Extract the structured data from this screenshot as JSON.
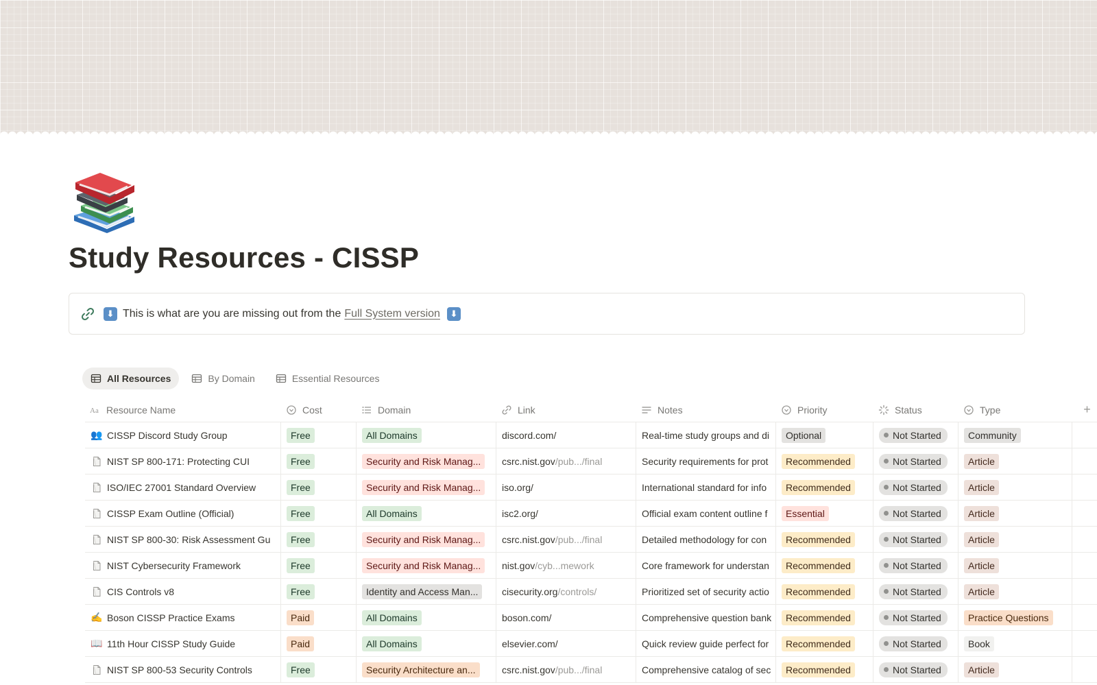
{
  "page": {
    "title": "Study Resources - CISSP",
    "icon": "books-icon"
  },
  "callout": {
    "icon": "link-icon",
    "text": "This is what are you are missing out from the",
    "link_text": "Full System version",
    "arrow_icon": "down-arrow-icon"
  },
  "views": [
    {
      "label": "All Resources",
      "active": true,
      "icon": "table-icon"
    },
    {
      "label": "By Domain",
      "active": false,
      "icon": "table-icon"
    },
    {
      "label": "Essential Resources",
      "active": false,
      "icon": "table-icon"
    }
  ],
  "columns": {
    "name": "Resource Name",
    "cost": "Cost",
    "domain": "Domain",
    "link": "Link",
    "notes": "Notes",
    "priority": "Priority",
    "status": "Status",
    "type": "Type",
    "add": "+"
  },
  "rows": [
    {
      "icon": "people-icon",
      "glyph": "👥",
      "name": "CISSP Discord Study Group",
      "cost": "Free",
      "domain": "All Domains",
      "link_main": "discord.com/",
      "link_dim": "",
      "notes": "Real-time study groups and di",
      "priority": "Optional",
      "status": "Not Started",
      "type": "Community"
    },
    {
      "icon": "document-icon",
      "glyph": "",
      "name": "NIST SP 800-171: Protecting CUI",
      "cost": "Free",
      "domain": "Security and Risk Manag...",
      "link_main": "csrc.nist.gov",
      "link_dim": "/pub.../final",
      "notes": "Security requirements for prot",
      "priority": "Recommended",
      "status": "Not Started",
      "type": "Article"
    },
    {
      "icon": "document-icon",
      "glyph": "",
      "name": "ISO/IEC 27001 Standard Overview",
      "cost": "Free",
      "domain": "Security and Risk Manag...",
      "link_main": "iso.org/",
      "link_dim": "",
      "notes": "International standard for info",
      "priority": "Recommended",
      "status": "Not Started",
      "type": "Article"
    },
    {
      "icon": "document-icon",
      "glyph": "",
      "name": "CISSP Exam Outline (Official)",
      "cost": "Free",
      "domain": "All Domains",
      "link_main": "isc2.org/",
      "link_dim": "",
      "notes": "Official exam content outline f",
      "priority": "Essential",
      "status": "Not Started",
      "type": "Article"
    },
    {
      "icon": "document-icon",
      "glyph": "",
      "name": "NIST SP 800-30: Risk Assessment Gu",
      "cost": "Free",
      "domain": "Security and Risk Manag...",
      "link_main": "csrc.nist.gov",
      "link_dim": "/pub.../final",
      "notes": "Detailed methodology for con",
      "priority": "Recommended",
      "status": "Not Started",
      "type": "Article"
    },
    {
      "icon": "document-icon",
      "glyph": "",
      "name": "NIST Cybersecurity Framework",
      "cost": "Free",
      "domain": "Security and Risk Manag...",
      "link_main": "nist.gov",
      "link_dim": "/cyb...mework",
      "notes": "Core framework for understan",
      "priority": "Recommended",
      "status": "Not Started",
      "type": "Article"
    },
    {
      "icon": "document-icon",
      "glyph": "",
      "name": "CIS Controls v8",
      "cost": "Free",
      "domain": "Identity and Access Man...",
      "link_main": "cisecurity.org",
      "link_dim": "/controls/",
      "notes": "Prioritized set of security actio",
      "priority": "Recommended",
      "status": "Not Started",
      "type": "Article"
    },
    {
      "icon": "writing-hand-icon",
      "glyph": "✍️",
      "name": "Boson CISSP Practice Exams",
      "cost": "Paid",
      "domain": "All Domains",
      "link_main": "boson.com/",
      "link_dim": "",
      "notes": "Comprehensive question bank",
      "priority": "Recommended",
      "status": "Not Started",
      "type": "Practice Questions"
    },
    {
      "icon": "open-book-icon",
      "glyph": "📖",
      "name": "11th Hour CISSP Study Guide",
      "cost": "Paid",
      "domain": "All Domains",
      "link_main": "elsevier.com/",
      "link_dim": "",
      "notes": "Quick review guide perfect for",
      "priority": "Recommended",
      "status": "Not Started",
      "type": "Book"
    },
    {
      "icon": "document-icon",
      "glyph": "",
      "name": "NIST SP 800-53 Security Controls",
      "cost": "Free",
      "domain": "Security Architecture an...",
      "link_main": "csrc.nist.gov",
      "link_dim": "/pub.../final",
      "notes": "Comprehensive catalog of sec",
      "priority": "Recommended",
      "status": "Not Started",
      "type": "Article"
    }
  ],
  "tag_colors": {
    "Free": "green",
    "Paid": "orange",
    "All Domains": "green",
    "Security and Risk Manag...": "red",
    "Identity and Access Man...": "gray",
    "Security Architecture an...": "orange",
    "Optional": "gray",
    "Recommended": "yellow",
    "Essential": "pink",
    "Community": "gray",
    "Article": "brown",
    "Practice Questions": "orange",
    "Book": "lightgray"
  }
}
